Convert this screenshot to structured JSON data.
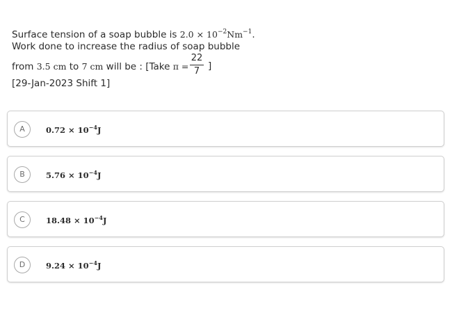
{
  "question": {
    "line1_prefix": "Surface tension of a soap bubble is ",
    "line1_value": "2.0 × 10",
    "line1_exp": "−2",
    "line1_unit": "Nm",
    "line1_unit_exp": "−1",
    "line1_end": ".",
    "line2": "Work done to increase the radius of soap bubble",
    "line3_from": "from ",
    "line3_r1": "3.5 cm",
    "line3_to": " to ",
    "line3_r2": "7 cm",
    "line3_rest": " will be : [Take ",
    "line3_pi": "π = ",
    "frac_num": "22",
    "frac_den": "7",
    "close": "]"
  },
  "meta": "[29-Jan-2023 Shift 1]",
  "options": [
    {
      "letter": "A",
      "mantissa": "0.72 × 10",
      "exp": "−4",
      "unit": "J"
    },
    {
      "letter": "B",
      "mantissa": "5.76 × 10",
      "exp": "−4",
      "unit": "J"
    },
    {
      "letter": "C",
      "mantissa": "18.48 × 10",
      "exp": "−4",
      "unit": "J"
    },
    {
      "letter": "D",
      "mantissa": "9.24 × 10",
      "exp": "−4",
      "unit": "J"
    }
  ]
}
